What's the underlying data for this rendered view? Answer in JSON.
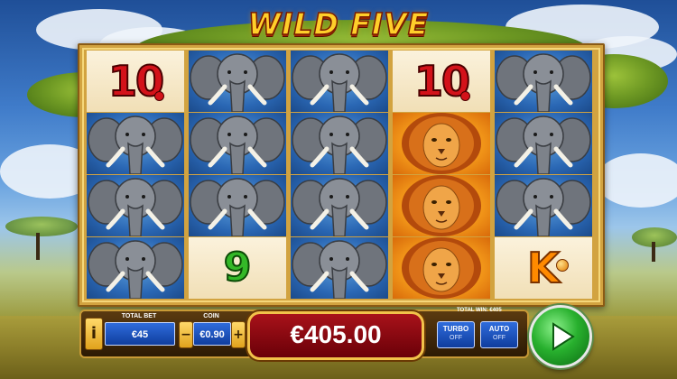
{
  "game": {
    "title": "WILD FIVE"
  },
  "reels": [
    [
      "ten",
      "elephant",
      "elephant",
      "elephant"
    ],
    [
      "elephant",
      "elephant",
      "elephant",
      "nine"
    ],
    [
      "elephant",
      "elephant",
      "elephant",
      "elephant"
    ],
    [
      "ten",
      "lion",
      "lion",
      "lion"
    ],
    [
      "elephant",
      "elephant",
      "elephant",
      "king"
    ]
  ],
  "symbols": {
    "ten": {
      "text": "10",
      "icon": "ten-cherry-icon"
    },
    "nine": {
      "text": "9",
      "icon": "nine-icon"
    },
    "king": {
      "text": "K",
      "icon": "king-icon"
    },
    "elephant": {
      "icon": "elephant-icon"
    },
    "lion": {
      "icon": "lion-icon"
    }
  },
  "controls": {
    "info_label": "i",
    "total_bet_label": "TOTAL BET",
    "total_bet_value": "€45",
    "coin_label": "COIN",
    "coin_value": "€0.90",
    "minus_label": "−",
    "plus_label": "+",
    "win_amount": "€405.00",
    "total_win_label": "TOTAL WIN: €405",
    "turbo_label": "TURBO",
    "turbo_state": "OFF",
    "auto_label": "AUTO",
    "auto_state": "OFF"
  },
  "colors": {
    "reel_frame": "#d2a340",
    "win_box": "#a8121a",
    "spin_button": "#28b02e"
  }
}
